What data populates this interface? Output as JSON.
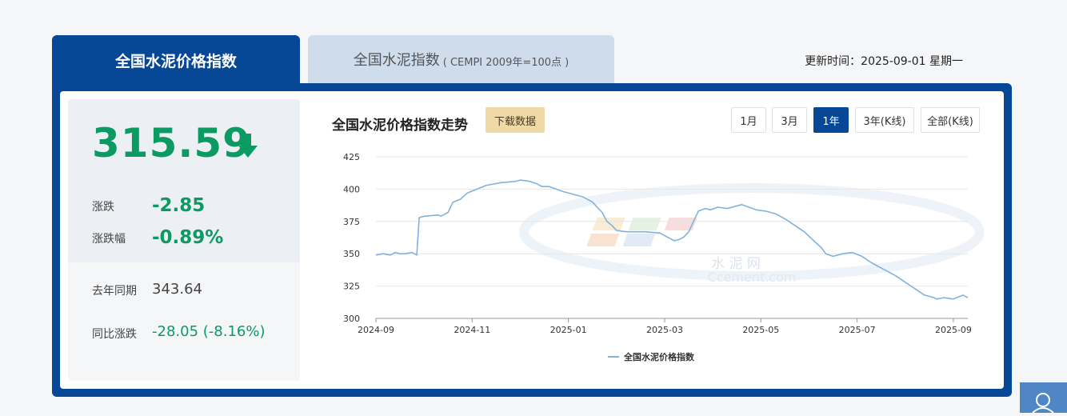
{
  "tabs": {
    "active": "全国水泥价格指数",
    "inactive_main": "全国水泥指数",
    "inactive_sub": "( CEMPI 2009年=100点 )"
  },
  "update_time": "更新时间：2025-09-01 星期一",
  "summary": {
    "value": "315.59",
    "change_label": "涨跌",
    "change_value": "-2.85",
    "change_pct_label": "涨跌幅",
    "change_pct_value": "-0.89%",
    "last_year_label": "去年同期",
    "last_year_value": "343.64",
    "yoy_label": "同比涨跌",
    "yoy_value": "-28.05",
    "yoy_pct": "(-8.16%)"
  },
  "chart_header": {
    "title": "全国水泥价格指数走势",
    "download": "下载数据",
    "ranges": [
      "1月",
      "3月",
      "1年",
      "3年(K线)",
      "全部(K线)"
    ],
    "active_range": "1年"
  },
  "colors": {
    "brand_blue": "#064796",
    "green": "#0c9a63",
    "line": "#7fb3de"
  },
  "chart_data": {
    "type": "line",
    "ylim": [
      300,
      425
    ],
    "yticks": [
      300,
      325,
      350,
      375,
      400,
      425
    ],
    "xticks": [
      {
        "label": "2024-09",
        "x": 0
      },
      {
        "label": "2024-11",
        "x": 2
      },
      {
        "label": "2025-01",
        "x": 4
      },
      {
        "label": "2025-03",
        "x": 6
      },
      {
        "label": "2025-05",
        "x": 8
      },
      {
        "label": "2025-07",
        "x": 10
      },
      {
        "label": "2025-09",
        "x": 12
      }
    ],
    "series": [
      {
        "name": "全国水泥价格指数",
        "x": [
          0,
          0.15,
          0.3,
          0.4,
          0.5,
          0.6,
          0.75,
          0.8,
          0.85,
          0.9,
          1.0,
          1.3,
          1.35,
          1.5,
          1.6,
          1.75,
          1.9,
          2.1,
          2.3,
          2.6,
          2.9,
          3.0,
          3.2,
          3.35,
          3.45,
          3.6,
          3.9,
          4.1,
          4.3,
          4.5,
          4.7,
          4.8,
          4.9,
          5.0,
          5.2,
          5.6,
          5.9,
          6.2,
          6.3,
          6.4,
          6.5,
          6.6,
          6.7,
          6.85,
          6.95,
          7.1,
          7.3,
          7.6,
          7.9,
          8.1,
          8.3,
          8.5,
          8.7,
          8.9,
          9.1,
          9.25,
          9.35,
          9.5,
          9.7,
          9.9,
          10.1,
          10.3,
          10.45,
          10.6,
          10.8,
          11.0,
          11.2,
          11.4,
          11.6,
          11.65,
          11.8,
          12.0,
          12.2,
          12.3
        ],
        "values": [
          349,
          350,
          349,
          351,
          350,
          350,
          351,
          350,
          349,
          378,
          379,
          380,
          379,
          382,
          390,
          392,
          397,
          400,
          403,
          405,
          406,
          407,
          406,
          404,
          402,
          402,
          398,
          396,
          394,
          390,
          382,
          375,
          372,
          368,
          367,
          367,
          366,
          360,
          361,
          363,
          367,
          375,
          383,
          385,
          384,
          386,
          385,
          388,
          384,
          383,
          381,
          377,
          372,
          367,
          360,
          355,
          350,
          348,
          350,
          351,
          348,
          343,
          340,
          337,
          333,
          328,
          323,
          318,
          316,
          315,
          316,
          315,
          318,
          316
        ]
      }
    ],
    "legend": "bottom"
  },
  "watermark": {
    "text_cn": "水 泥 网",
    "text_en": "Ccement.com"
  }
}
